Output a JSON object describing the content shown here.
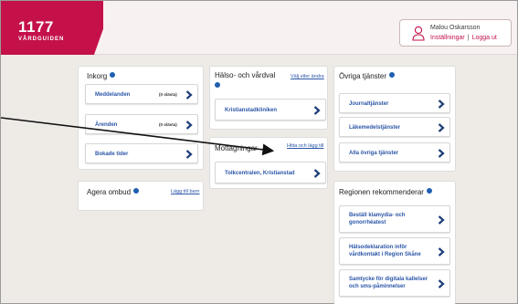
{
  "header": {
    "logo_number": "1177",
    "logo_sub": "VÅRDGUIDEN",
    "user_name": "Malou Oskarsson",
    "settings_link": "Inställningar",
    "separator": "|",
    "logout_link": "Logga ut"
  },
  "inkorg": {
    "title": "Inkorg",
    "items": [
      {
        "label": "Meddelanden",
        "badge": "(0 olästa)"
      },
      {
        "label": "Ärenden",
        "badge": "(0 olästa)"
      },
      {
        "label": "Bokade tider",
        "badge": ""
      }
    ]
  },
  "ombud": {
    "title": "Agera ombud",
    "link": "Lägg till barn"
  },
  "halso": {
    "title": "Hälso- och vårdval",
    "link": "Välj eller ändra",
    "item": "Kristianstadkliniken"
  },
  "mottagningar": {
    "title": "Mottagningar",
    "link": "Hitta och lägg till",
    "item": "Tolkcentralen, Kristianstad"
  },
  "ovriga": {
    "title": "Övriga tjänster",
    "items": [
      {
        "label": "Journaltjänster"
      },
      {
        "label": "Läkemedelstjänster"
      },
      {
        "label": "Alla övriga tjänster"
      }
    ]
  },
  "region": {
    "title": "Regionen rekommenderar",
    "items": [
      {
        "line1": "Beställ klamydia- och",
        "line2": "gonorrhéatest"
      },
      {
        "line1": "Hälsodeklaration inför",
        "line2": "vårdkontakt i Region Skåne"
      },
      {
        "line1": "Samtycke för digitala kallelser",
        "line2": "och sms-påminnelser"
      }
    ]
  },
  "colors": {
    "brand": "#c4114a",
    "link": "#2b56a8",
    "info": "#1f5fb0"
  }
}
